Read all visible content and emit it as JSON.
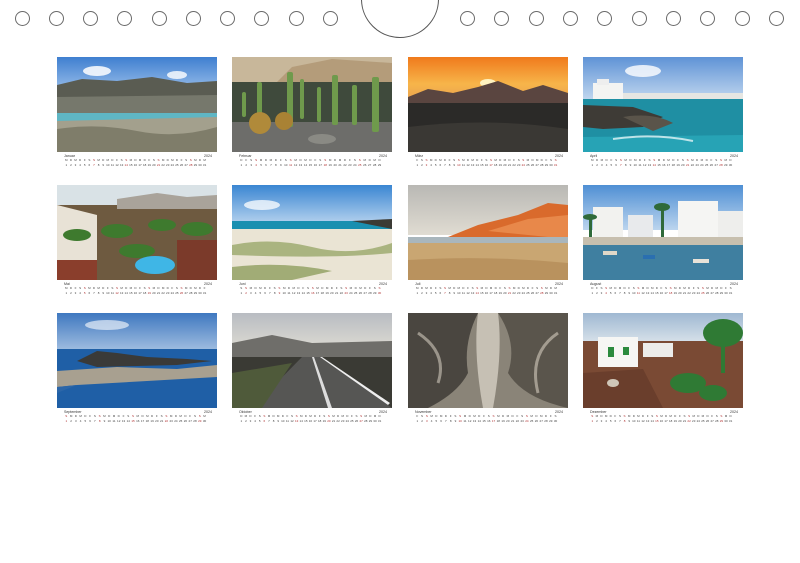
{
  "calendar": {
    "year": "2024",
    "day_letters": [
      "M",
      "D",
      "M",
      "D",
      "F",
      "S",
      "S"
    ],
    "months": [
      {
        "name": "Januar",
        "days": 31,
        "start": 0,
        "scene": "coast"
      },
      {
        "name": "Februar",
        "days": 29,
        "start": 3,
        "scene": "cactus"
      },
      {
        "name": "März",
        "days": 31,
        "start": 4,
        "scene": "sunset"
      },
      {
        "name": "April",
        "days": 30,
        "start": 0,
        "scene": "village-coast"
      },
      {
        "name": "Mai",
        "days": 31,
        "start": 2,
        "scene": "garden"
      },
      {
        "name": "Juni",
        "days": 30,
        "start": 5,
        "scene": "beach"
      },
      {
        "name": "Juli",
        "days": 31,
        "start": 0,
        "scene": "cliff-beach"
      },
      {
        "name": "August",
        "days": 31,
        "start": 3,
        "scene": "harbour"
      },
      {
        "name": "September",
        "days": 30,
        "start": 6,
        "scene": "island"
      },
      {
        "name": "Oktober",
        "days": 31,
        "start": 1,
        "scene": "road"
      },
      {
        "name": "November",
        "days": 30,
        "start": 4,
        "scene": "canyon"
      },
      {
        "name": "Dezember",
        "days": 31,
        "start": 6,
        "scene": "white-house"
      }
    ]
  },
  "colors": {
    "ring_stroke": "#6a6a6a",
    "sunday": "#b03030"
  }
}
